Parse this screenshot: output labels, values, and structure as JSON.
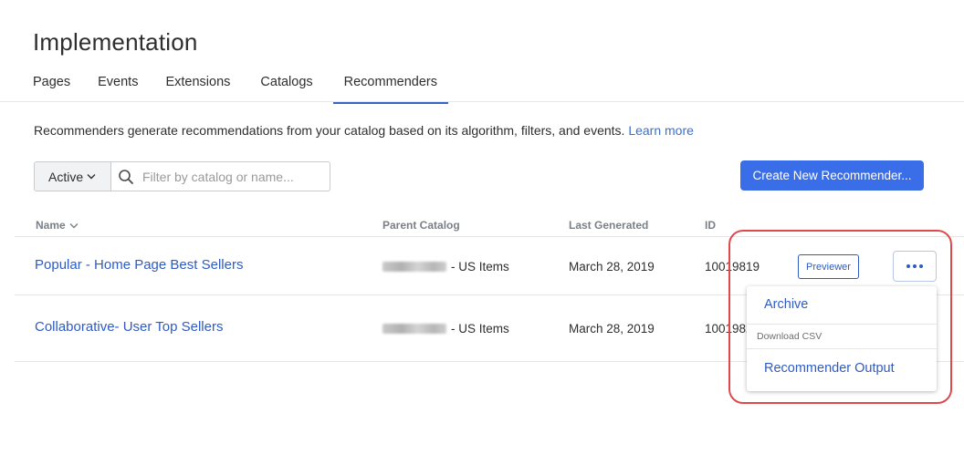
{
  "page": {
    "title": "Implementation"
  },
  "tabs": [
    {
      "label": "Pages",
      "active": false
    },
    {
      "label": "Events",
      "active": false
    },
    {
      "label": "Extensions",
      "active": false
    },
    {
      "label": "Catalogs",
      "active": false
    },
    {
      "label": "Recommenders",
      "active": true
    }
  ],
  "description": {
    "text": "Recommenders generate recommendations from your catalog based on its algorithm, filters, and events.",
    "link": "Learn more"
  },
  "filters": {
    "status": "Active",
    "search_placeholder": "Filter by catalog or name...",
    "search_value": ""
  },
  "create_button": "Create New Recommender...",
  "table": {
    "columns": {
      "name": "Name",
      "parent_catalog": "Parent Catalog",
      "last_generated": "Last Generated",
      "id": "ID"
    },
    "rows": [
      {
        "name": "Popular - Home Page Best Sellers",
        "parent_catalog": "- US Items",
        "last_generated": "March 28, 2019",
        "id": "10019819",
        "action": "Previewer"
      },
      {
        "name": "Collaborative- User Top Sellers",
        "parent_catalog": "- US Items",
        "last_generated": "March 28, 2019",
        "id": "10019820"
      }
    ]
  },
  "row_menu": {
    "archive": "Archive",
    "section_header": "Download CSV",
    "output": "Recommender Output"
  },
  "colors": {
    "accent": "#3a6ee8",
    "link": "#2f5bc3",
    "highlight": "#e0484c"
  },
  "icons": {
    "status_dropdown": "chevron-down-icon",
    "search": "search-icon",
    "sort": "chevron-down-icon",
    "more": "ellipsis-icon"
  }
}
